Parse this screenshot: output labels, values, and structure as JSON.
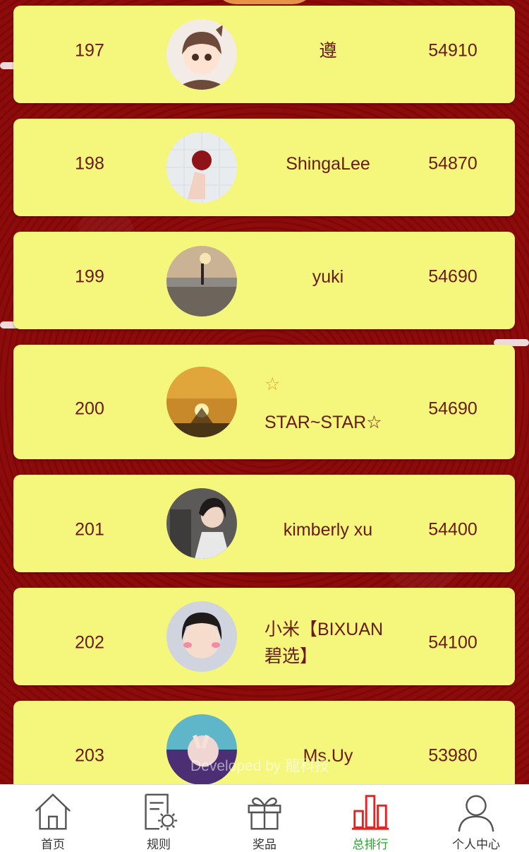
{
  "leaderboard": {
    "rows": [
      {
        "rank": "197",
        "name": "遵",
        "score": "54910",
        "avatar": "cartoon-girl-avatar"
      },
      {
        "rank": "198",
        "name": "ShingaLee",
        "score": "54870",
        "avatar": "rose-hand-avatar"
      },
      {
        "rank": "199",
        "name": "yuki",
        "score": "54690",
        "avatar": "beach-sunset-avatar"
      },
      {
        "rank": "200",
        "name_line1": "☆",
        "name_line2": "STAR~STAR☆",
        "score": "54690",
        "avatar": "sunset-avatar"
      },
      {
        "rank": "201",
        "name": "kimberly xu",
        "score": "54400",
        "avatar": "photo-girl-avatar"
      },
      {
        "rank": "202",
        "name_line1": "小米【BIXUAN",
        "name_line2": "碧选】",
        "score": "54100",
        "avatar": "selfie-girl-avatar"
      },
      {
        "rank": "203",
        "name": "Ms.Uy",
        "score": "53980",
        "avatar": "peace-sign-avatar"
      }
    ]
  },
  "footer": {
    "watermark": "Developed by 龍科技"
  },
  "tabbar": {
    "active": "ranking",
    "active_color": "#27a52c",
    "tabs": [
      {
        "label": "首页",
        "icon": "home-icon"
      },
      {
        "label": "规则",
        "icon": "rules-document-icon"
      },
      {
        "label": "奖品",
        "icon": "gift-icon"
      },
      {
        "label": "总排行",
        "icon": "bar-chart-icon"
      },
      {
        "label": "个人中心",
        "icon": "user-icon"
      }
    ]
  },
  "colors": {
    "card": "#f4f77c",
    "text": "#6b1a0f",
    "background": "#8e0c0c"
  }
}
